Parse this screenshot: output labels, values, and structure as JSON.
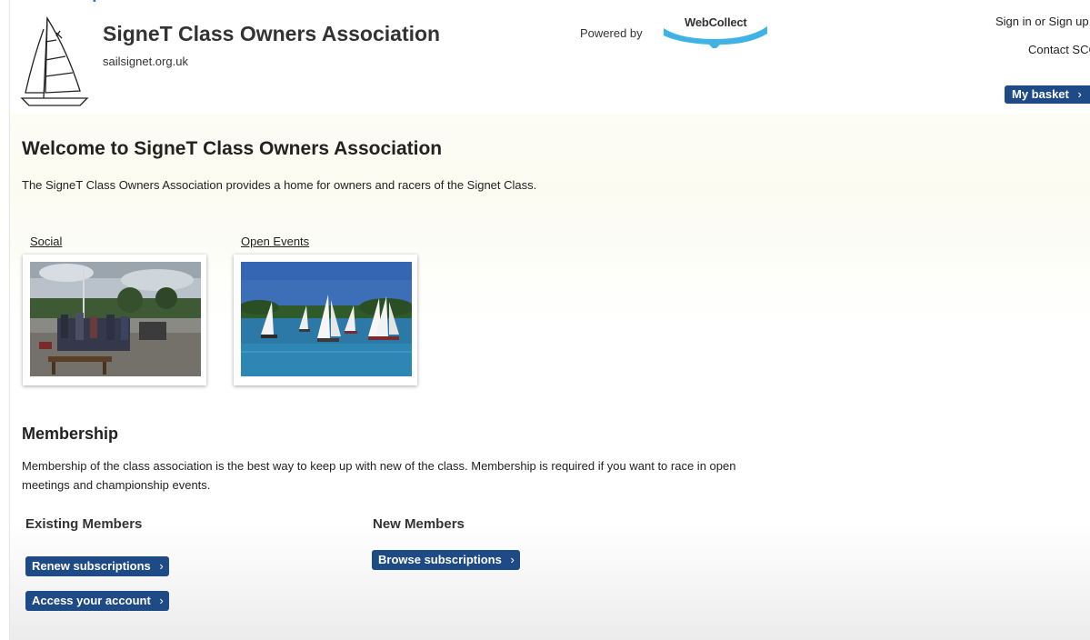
{
  "header": {
    "org_name": "SigneT Class Owners Association",
    "org_url": "sailsignet.org.uk",
    "powered_by": "Powered by",
    "webcollect": "WebCollect",
    "signin": "Sign in or Sign up",
    "contact": "Contact SCOA",
    "basket": "My basket"
  },
  "welcome": {
    "title": "Welcome to SigneT Class Owners Association",
    "intro": "The SigneT Class Owners Association provides a home for owners and racers of the Signet Class."
  },
  "tiles": [
    {
      "label": "Social"
    },
    {
      "label": "Open Events"
    }
  ],
  "membership": {
    "title": "Membership",
    "text": "Membership of the class association is the best way to keep up with new of the class. Membership is required if you want to race in open meetings and championship events.",
    "existing_title": "Existing Members",
    "new_title": "New Members",
    "renew": "Renew subscriptions",
    "access": "Access your account",
    "browse": "Browse subscriptions"
  },
  "colors": {
    "button": "#1e4a86",
    "webcollect_blue": "#3fb3e6"
  },
  "icons": {
    "chevron": "›"
  }
}
